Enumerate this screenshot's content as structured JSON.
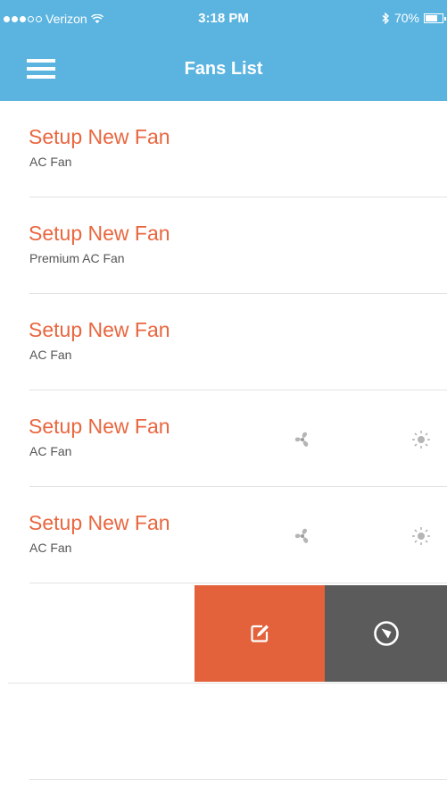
{
  "status_bar": {
    "carrier": "Verizon",
    "time": "3:18 PM",
    "battery": "70%",
    "battery_level": 0.7
  },
  "nav": {
    "title": "Fans List",
    "menu_icon": "hamburger-menu-icon"
  },
  "fans": [
    {
      "name": "Setup New Fan",
      "type": "AC Fan",
      "controls": false
    },
    {
      "name": "Setup New Fan",
      "type": "Premium AC Fan",
      "controls": false
    },
    {
      "name": "Setup New Fan",
      "type": "AC Fan",
      "controls": false
    },
    {
      "name": "Setup New Fan",
      "type": "AC Fan",
      "controls": true
    },
    {
      "name": "Setup New Fan",
      "type": "AC Fan",
      "controls": true
    }
  ],
  "swipe_actions": {
    "edit_icon": "edit-icon",
    "locate_icon": "compass-icon"
  },
  "colors": {
    "header": "#5bb4e0",
    "accent": "#e9663f",
    "edit_action": "#e4623b",
    "locate_action": "#5b5b5b"
  }
}
